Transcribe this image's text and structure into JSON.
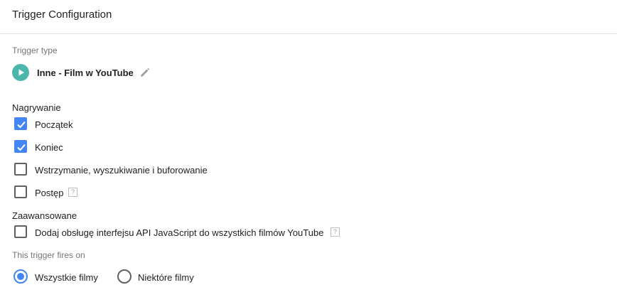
{
  "header": {
    "title": "Trigger Configuration"
  },
  "trigger_type": {
    "label": "Trigger type",
    "name": "Inne - Film w YouTube",
    "icon": "play-icon",
    "icon_color": "#4db6ac"
  },
  "capture": {
    "heading": "Nagrywanie",
    "options": [
      {
        "label": "Początek",
        "checked": true
      },
      {
        "label": "Koniec",
        "checked": true
      },
      {
        "label": "Wstrzymanie, wyszukiwanie i buforowanie",
        "checked": false
      },
      {
        "label": "Postęp",
        "checked": false,
        "help": "?"
      }
    ]
  },
  "advanced": {
    "heading": "Zaawansowane",
    "options": [
      {
        "label": "Dodaj obsługę interfejsu API JavaScript do wszystkich filmów YouTube",
        "checked": false,
        "help": "?"
      }
    ]
  },
  "fires_on": {
    "label": "This trigger fires on",
    "options": [
      {
        "label": "Wszystkie filmy",
        "selected": true
      },
      {
        "label": "Niektóre filmy",
        "selected": false
      }
    ]
  },
  "colors": {
    "accent": "#4285f4",
    "teal": "#4db6ac"
  }
}
